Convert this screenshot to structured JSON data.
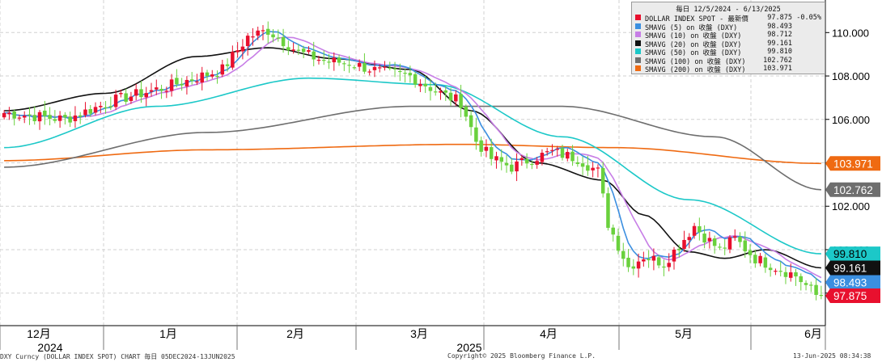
{
  "chart_data": {
    "type": "candlestick",
    "date_range_label": "毎日 12/5/2024 - 6/13/2025",
    "y_axis": {
      "side": "right",
      "range": [
        96.5,
        111.5
      ],
      "ticks": [
        "110.000",
        "108.000",
        "106.000",
        "104.000",
        "102.000",
        "100.000",
        "98.000"
      ]
    },
    "x_axis": {
      "months": [
        "12月",
        "1月",
        "2月",
        "3月",
        "4月",
        "5月",
        "6月"
      ],
      "years": [
        "2024",
        "2025"
      ]
    },
    "grid": true,
    "legend": {
      "placement": "top-right",
      "entries": [
        {
          "name": "DOLLAR INDEX SPOT - 最新價",
          "value": "97.875",
          "change": "-0.05%",
          "color": "#e8102e"
        },
        {
          "name": "SMAVG (5)  on 收盤 (DXY)",
          "value": "98.493",
          "color": "#3b8fe0"
        },
        {
          "name": "SMAVG (10)  on 收盤 (DXY)",
          "value": "98.712",
          "color": "#c77ee6"
        },
        {
          "name": "SMAVG (20)  on 收盤 (DXY)",
          "value": "99.161",
          "color": "#111111"
        },
        {
          "name": "SMAVG (50)  on 收盤 (DXY)",
          "value": "99.810",
          "color": "#1cc8c8"
        },
        {
          "name": "SMAVG (100)  on 收盤 (DXY)",
          "value": "102.762",
          "color": "#6e6e6e"
        },
        {
          "name": "SMAVG (200)  on 收盤 (DXY)",
          "value": "103.971",
          "color": "#ef6a12"
        }
      ]
    },
    "price_path": [
      [
        0,
        106.3
      ],
      [
        12,
        106.0
      ],
      [
        22,
        106.9
      ],
      [
        32,
        107.5
      ],
      [
        43,
        108.3
      ],
      [
        48,
        109.8
      ],
      [
        52,
        110.1
      ],
      [
        58,
        109.1
      ],
      [
        63,
        108.7
      ],
      [
        68,
        108.6
      ],
      [
        74,
        108.2
      ],
      [
        80,
        108.0
      ],
      [
        86,
        107.2
      ],
      [
        90,
        106.8
      ],
      [
        93,
        105.0
      ],
      [
        96,
        104.2
      ],
      [
        100,
        103.8
      ],
      [
        104,
        104.2
      ],
      [
        108,
        104.5
      ],
      [
        113,
        104.2
      ],
      [
        117,
        103.6
      ],
      [
        119,
        101.2
      ],
      [
        121,
        100.2
      ],
      [
        123,
        99.2
      ],
      [
        126,
        99.7
      ],
      [
        130,
        99.4
      ],
      [
        133,
        100.2
      ],
      [
        136,
        101.1
      ],
      [
        138,
        100.6
      ],
      [
        141,
        100.0
      ],
      [
        144,
        100.5
      ],
      [
        148,
        99.6
      ],
      [
        152,
        99.2
      ],
      [
        156,
        98.8
      ],
      [
        160,
        97.9
      ]
    ],
    "series_end_values": [
      {
        "name": "SMAVG (50)",
        "label": "99.810",
        "color": "#1cc8c8"
      },
      {
        "name": "SMAVG (20)",
        "label": "99.161",
        "color": "#111111"
      },
      {
        "name": "SMAVG (5)",
        "label": "98.493",
        "color": "#3b8fe0"
      },
      {
        "name": "DOLLAR INDEX SPOT",
        "label": "97.875",
        "color": "#e8102e"
      },
      {
        "name": "SMAVG (200)",
        "label": "103.971",
        "color": "#ef6a12"
      },
      {
        "name": "SMAVG (100)",
        "label": "102.762",
        "color": "#6e6e6e"
      }
    ]
  },
  "footer": {
    "left": "DXY Curncy (DOLLAR INDEX SPOT) CHART  毎日 05DEC2024-13JUN2025",
    "center": "Copyright© 2025 Bloomberg Finance L.P.",
    "right": "13-Jun-2025 08:34:38"
  }
}
